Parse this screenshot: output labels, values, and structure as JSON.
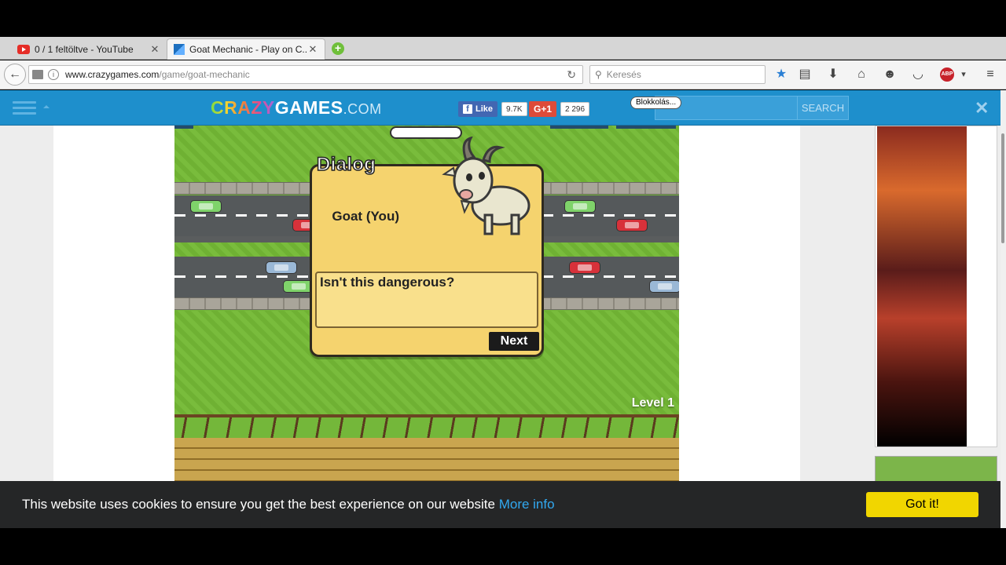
{
  "browser": {
    "tabs": [
      {
        "title": "0 / 1 feltöltve - YouTube",
        "close": "✕"
      },
      {
        "title": "Goat Mechanic - Play on C...",
        "close": "✕"
      }
    ],
    "new_tab": "+",
    "url_domain": "www.crazygames.com",
    "url_path": "/game/goat-mechanic",
    "search_placeholder": "Keresés"
  },
  "site": {
    "logo_crazy": "CRAZY",
    "logo_games": "GAMES",
    "logo_com": ".COM",
    "fb_label": "Like",
    "fb_count": "9.7K",
    "gplus_label": "G+1",
    "gplus_count": "2 296",
    "tooltip": "Blokkolás...",
    "search_button": "SEARCH",
    "close": "✕"
  },
  "game": {
    "dialog_title": "Dialog",
    "speaker": "Goat (You)",
    "line": "Isn't this dangerous?",
    "next": "Next",
    "level": "Level 1"
  },
  "cookie": {
    "message": "This website uses cookies to ensure you get the best experience on our website",
    "more": "More info",
    "button": "Got it!"
  },
  "colors": {
    "site_header": "#1e8fcc",
    "dialog_bg": "#f5d36e",
    "cookie_button": "#f1d600",
    "grass": "#74b73a"
  }
}
